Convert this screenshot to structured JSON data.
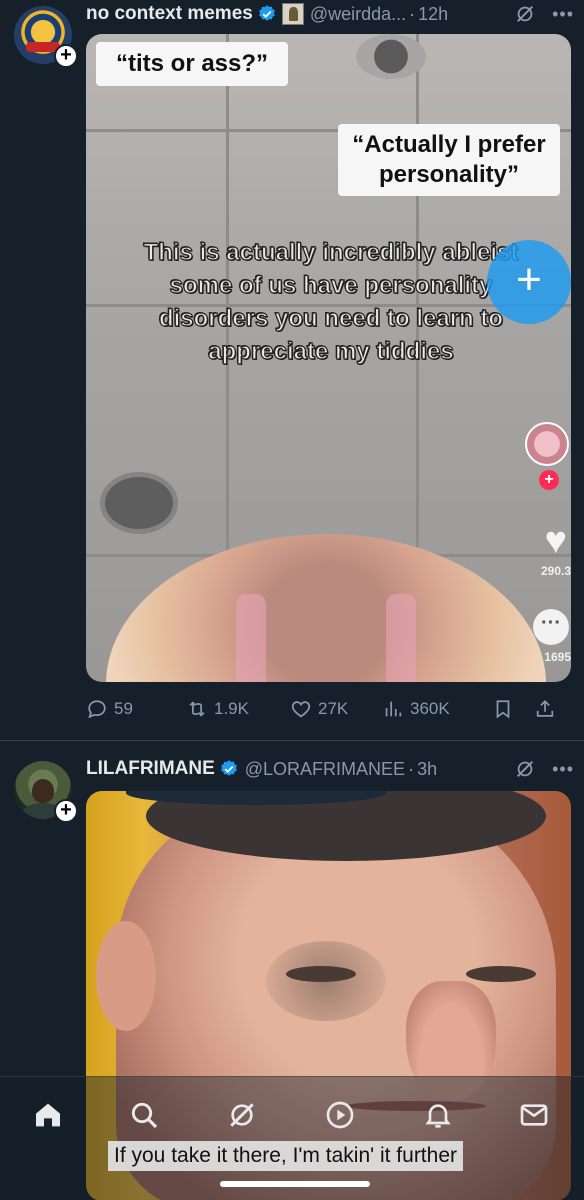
{
  "posts": [
    {
      "author": {
        "name": "no context memes",
        "handle": "@weirdda...",
        "time": "12h"
      },
      "media": {
        "caption_top": "“tits or ass?”",
        "caption_reply": "“Actually I prefer personality”",
        "overlay_text": "This is actually incredibly ableist some of us have personality disorders you need to learn to appreciate my tiddies",
        "tiktok_likes": "290.3",
        "tiktok_comments": "1695"
      },
      "actions": {
        "replies": "59",
        "reposts": "1.9K",
        "likes": "27K",
        "views": "360K"
      }
    },
    {
      "author": {
        "name": "LILAFRIMANE",
        "handle": "@LORAFRIMANEE",
        "time": "3h"
      },
      "media": {
        "subtitle": "If you take it there, I'm takin' it further"
      }
    }
  ],
  "icons": {
    "verified": "verified-badge-icon",
    "grok": "grok-icon",
    "more": "more-icon",
    "reply": "reply-icon",
    "repost": "repost-icon",
    "like": "heart-icon",
    "views": "views-icon",
    "bookmark": "bookmark-icon",
    "share": "share-icon"
  },
  "tabs": [
    "home",
    "search",
    "grok",
    "video",
    "notifications",
    "messages"
  ],
  "fab": {
    "label": "+"
  },
  "colors": {
    "background": "#15202b",
    "accent": "#1d9bf0",
    "muted": "#8b98a5"
  }
}
